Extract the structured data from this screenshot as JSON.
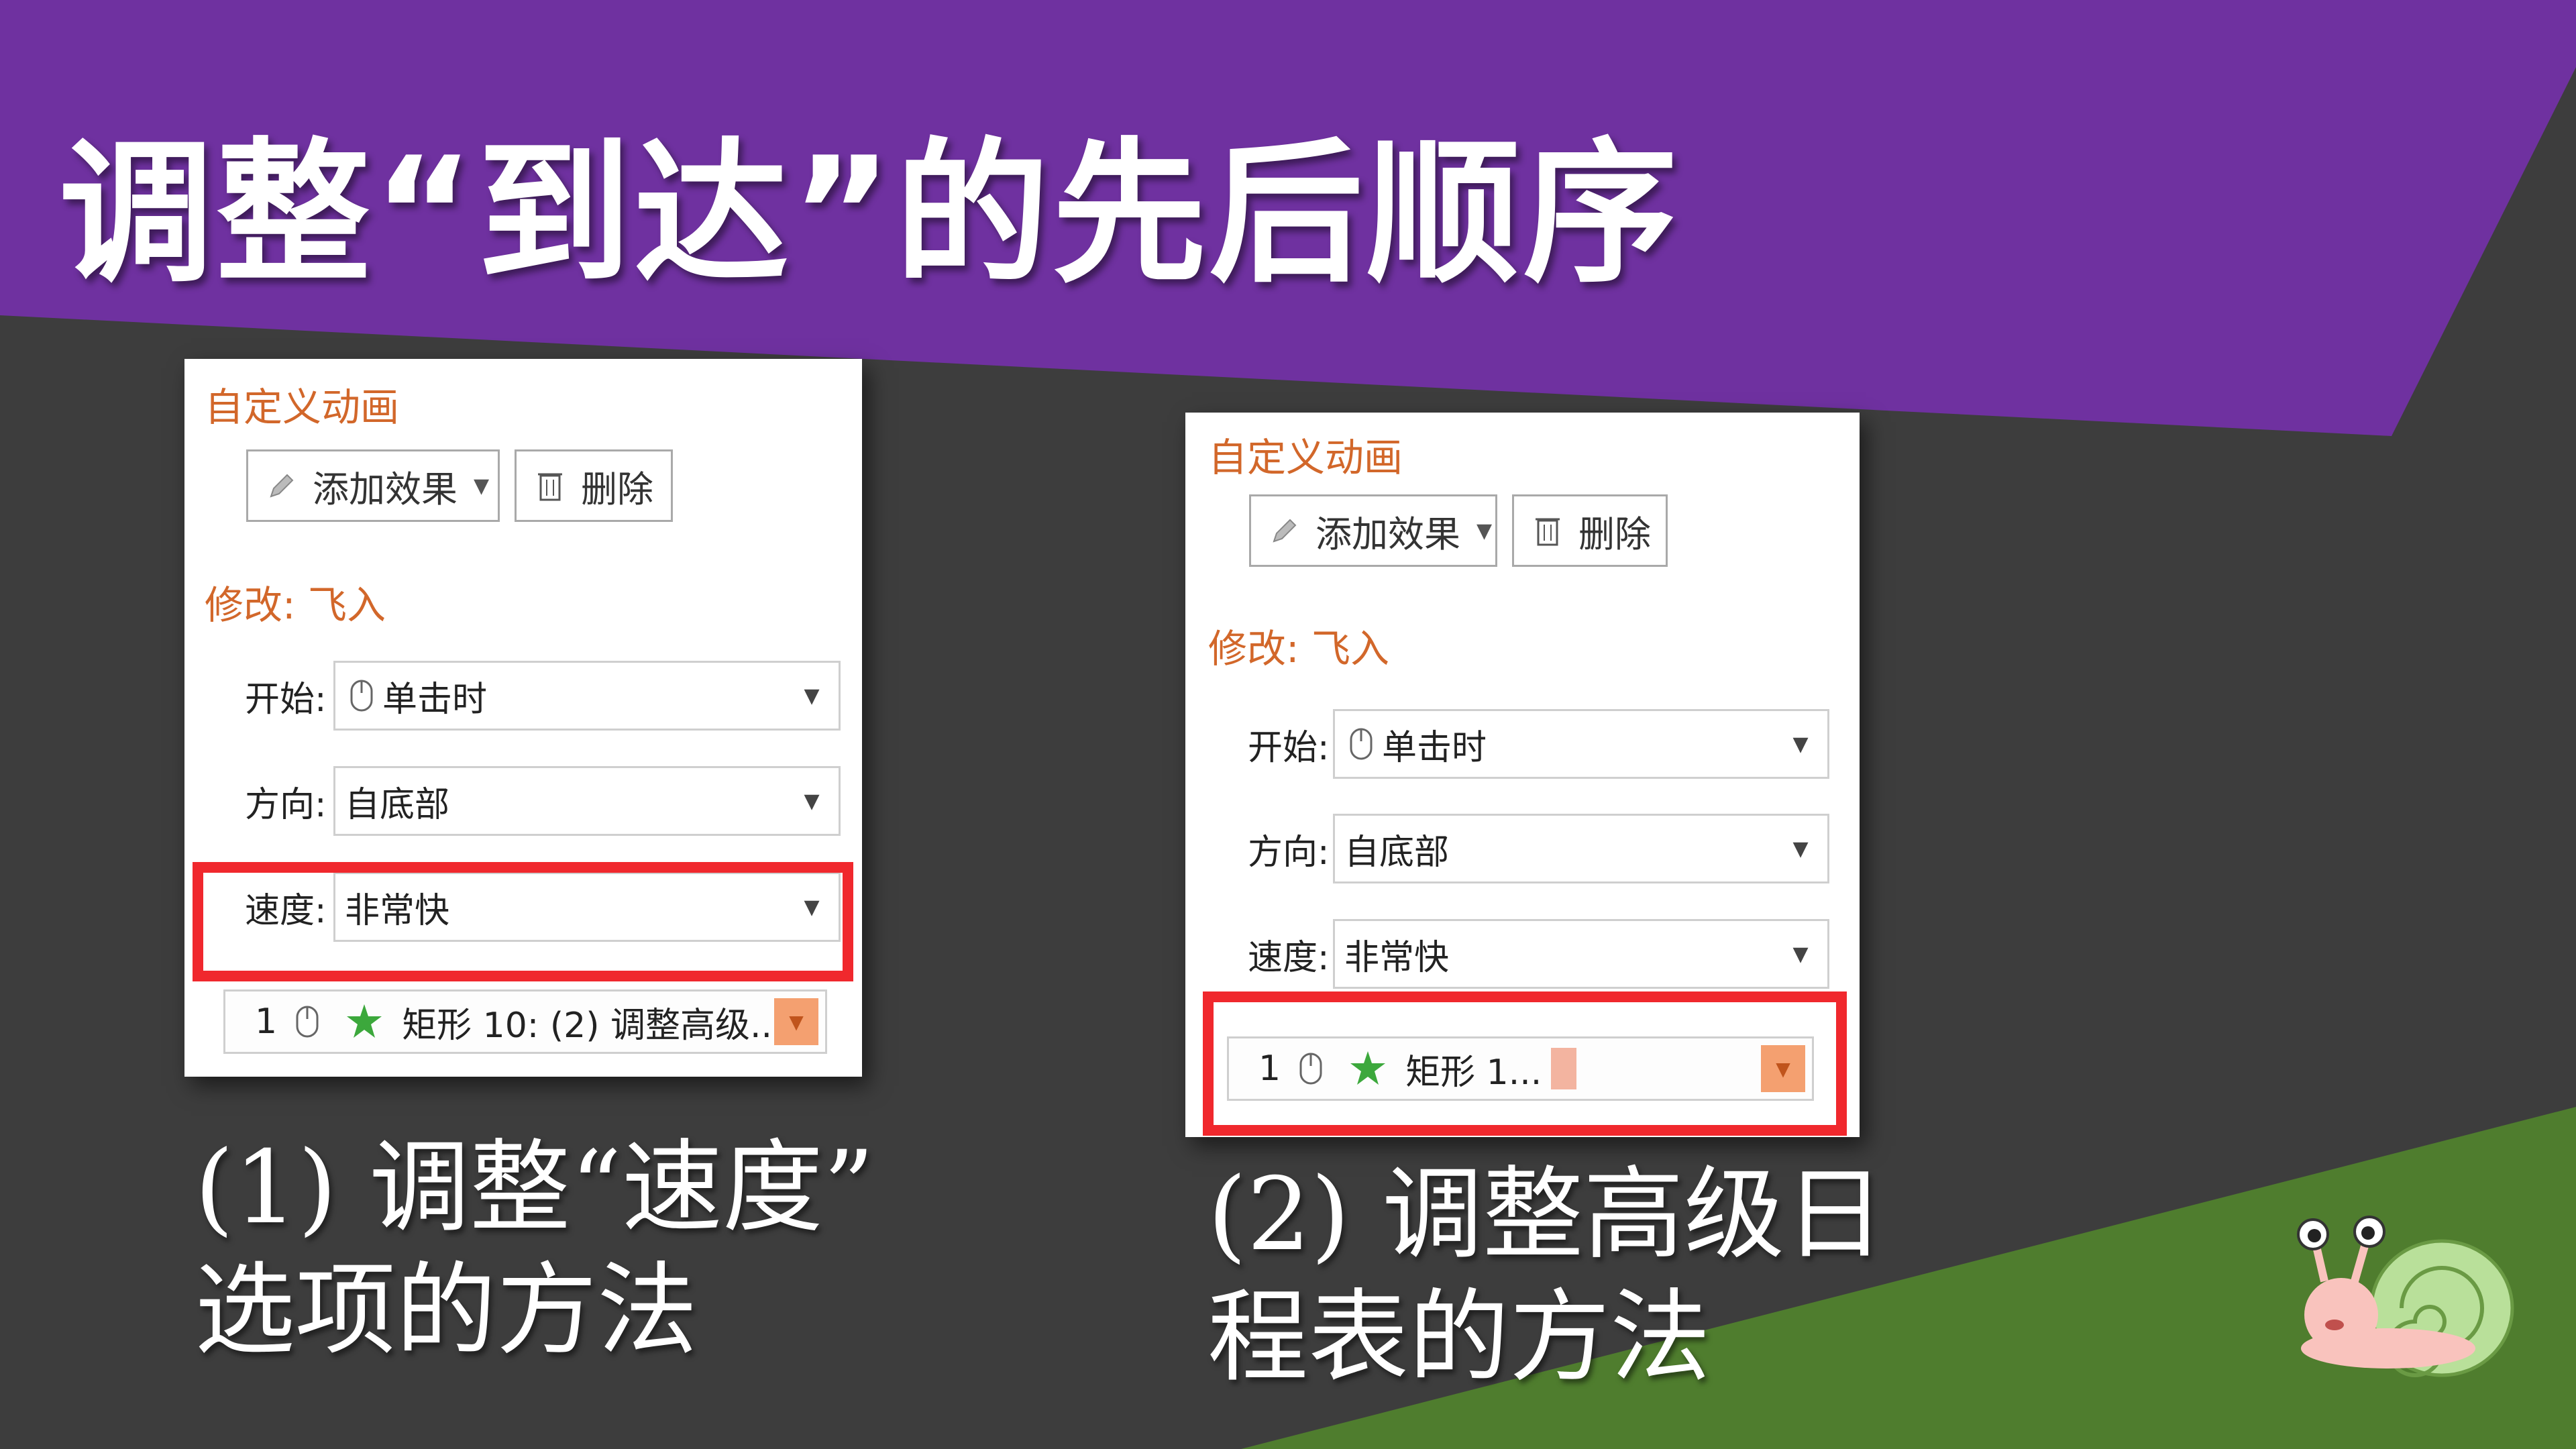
{
  "title": "调整“到达”的先后顺序",
  "colors": {
    "purple": "#6f31a0",
    "green": "#4f7d2e",
    "dark": "#3d3d3d",
    "accent_orange": "#d2672a",
    "highlight_red": "#f0282d"
  },
  "panel_left": {
    "header": "自定义动画",
    "add_effect_label": "添加效果",
    "delete_label": "删除",
    "modify_label": "修改: 飞入",
    "start_label": "开始:",
    "start_value": "单击时",
    "direction_label": "方向:",
    "direction_value": "自底部",
    "speed_label": "速度:",
    "speed_value": "非常快",
    "list_item_num": "1",
    "list_item_text": "矩形 10: (2) 调整高级..."
  },
  "panel_right": {
    "header": "自定义动画",
    "add_effect_label": "添加效果",
    "delete_label": "删除",
    "modify_label": "修改: 飞入",
    "start_label": "开始:",
    "start_value": "单击时",
    "direction_label": "方向:",
    "direction_value": "自底部",
    "speed_label": "速度:",
    "speed_value": "非常快",
    "list_item_num": "1",
    "list_item_text": "矩形 1..."
  },
  "caption_left": {
    "line1": "(1) 调整“速度”",
    "line2": "选项的方法"
  },
  "caption_right": {
    "line1": "(2) 调整高级日",
    "line2": "程表的方法"
  },
  "icons": [
    "pencil-icon",
    "trash-icon",
    "mouse-icon",
    "star-effect-icon",
    "dropdown-caret-icon",
    "snail-mascot"
  ]
}
